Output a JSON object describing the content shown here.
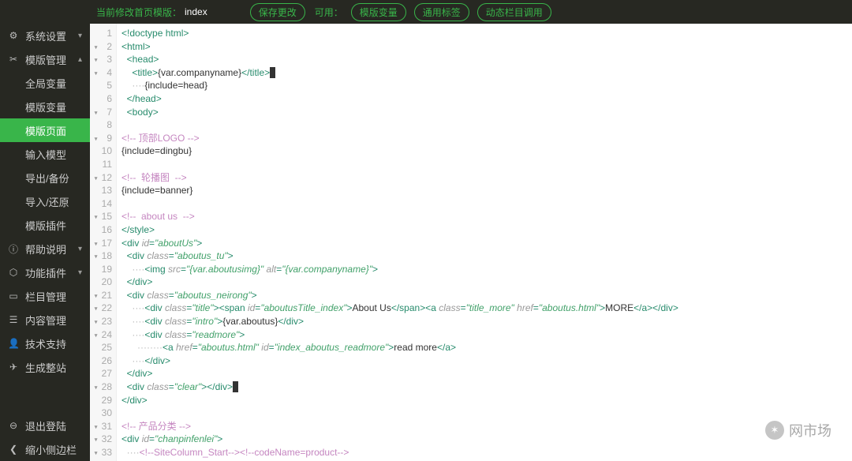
{
  "topbar": {
    "crumb_prefix": "当前修改首页模版：",
    "crumb_value": "index",
    "save_label": "保存更改",
    "avail_label": "可用：",
    "btn_tpl_var": "模版变量",
    "btn_common_tag": "通用标签",
    "btn_dynamic_col": "动态栏目调用"
  },
  "sidebar": {
    "items": [
      {
        "icon": "⚙",
        "label": "系统设置",
        "chev": "▾",
        "sub": false
      },
      {
        "icon": "✂",
        "label": "模版管理",
        "chev": "▴",
        "sub": false
      },
      {
        "icon": "",
        "label": "全局变量",
        "sub": true
      },
      {
        "icon": "",
        "label": "模版变量",
        "sub": true
      },
      {
        "icon": "",
        "label": "模版页面",
        "sub": true,
        "active": true
      },
      {
        "icon": "",
        "label": "输入模型",
        "sub": true
      },
      {
        "icon": "",
        "label": "导出/备份",
        "sub": true
      },
      {
        "icon": "",
        "label": "导入/还原",
        "sub": true
      },
      {
        "icon": "",
        "label": "模版插件",
        "sub": true
      },
      {
        "icon": "ⓘ",
        "label": "帮助说明",
        "chev": "▾",
        "sub": false
      },
      {
        "icon": "⬡",
        "label": "功能插件",
        "chev": "▾",
        "sub": false
      },
      {
        "icon": "▭",
        "label": "栏目管理",
        "sub": false
      },
      {
        "icon": "☰",
        "label": "内容管理",
        "sub": false
      },
      {
        "icon": "👤",
        "label": "技术支持",
        "sub": false
      },
      {
        "icon": "✈",
        "label": "生成整站",
        "sub": false
      }
    ],
    "footer": [
      {
        "icon": "⊖",
        "label": "退出登陆"
      },
      {
        "icon": "❮",
        "label": "缩小侧边栏"
      }
    ]
  },
  "watermark": {
    "text": "网市场"
  },
  "code_lines": [
    {
      "n": 1,
      "indent": 0,
      "raw": "<!doctype html>",
      "type": "tag"
    },
    {
      "n": 2,
      "fold": true,
      "indent": 0,
      "parts": [
        {
          "t": "tag",
          "s": "<html>"
        }
      ]
    },
    {
      "n": 3,
      "fold": true,
      "indent": 1,
      "parts": [
        {
          "t": "tag",
          "s": "<head>"
        }
      ]
    },
    {
      "n": 4,
      "fold": true,
      "indent": 2,
      "parts": [
        {
          "t": "tag",
          "s": "<title>"
        },
        {
          "t": "text",
          "s": "{var.companyname}"
        },
        {
          "t": "tag",
          "s": "</title>"
        },
        {
          "t": "cur",
          "s": "_"
        }
      ]
    },
    {
      "n": 5,
      "indent": 2,
      "parts": [
        {
          "t": "inv",
          "s": "····"
        },
        {
          "t": "text",
          "s": "{include=head}"
        }
      ]
    },
    {
      "n": 6,
      "indent": 1,
      "parts": [
        {
          "t": "tag",
          "s": "</head>"
        }
      ]
    },
    {
      "n": 7,
      "fold": true,
      "indent": 1,
      "parts": [
        {
          "t": "tag",
          "s": "<body>"
        }
      ]
    },
    {
      "n": 8,
      "indent": 0,
      "parts": []
    },
    {
      "n": 9,
      "fold": true,
      "indent": 0,
      "parts": [
        {
          "t": "comment",
          "s": "<!-- 顶部LOGO -->"
        }
      ]
    },
    {
      "n": 10,
      "indent": 0,
      "parts": [
        {
          "t": "text",
          "s": "{include=dingbu}"
        }
      ]
    },
    {
      "n": 11,
      "indent": 0,
      "parts": []
    },
    {
      "n": 12,
      "fold": true,
      "indent": 0,
      "parts": [
        {
          "t": "comment",
          "s": "<!--  轮播图  -->"
        }
      ]
    },
    {
      "n": 13,
      "indent": 0,
      "parts": [
        {
          "t": "text",
          "s": "{include=banner}"
        }
      ]
    },
    {
      "n": 14,
      "indent": 0,
      "parts": []
    },
    {
      "n": 15,
      "fold": true,
      "indent": 0,
      "parts": [
        {
          "t": "comment",
          "s": "<!--  about us  -->"
        }
      ]
    },
    {
      "n": 16,
      "indent": 0,
      "parts": [
        {
          "t": "tag",
          "s": "</"
        },
        {
          "t": "tagname",
          "s": "style"
        },
        {
          "t": "tag",
          "s": ">"
        }
      ]
    },
    {
      "n": 17,
      "fold": true,
      "indent": 0,
      "parts": [
        {
          "t": "tag",
          "s": "<div "
        },
        {
          "t": "attr",
          "s": "id"
        },
        {
          "t": "tag",
          "s": "="
        },
        {
          "t": "str",
          "s": "\"aboutUs\""
        },
        {
          "t": "tag",
          "s": ">"
        }
      ]
    },
    {
      "n": 18,
      "fold": true,
      "indent": 1,
      "parts": [
        {
          "t": "tag",
          "s": "<div "
        },
        {
          "t": "attr",
          "s": "class"
        },
        {
          "t": "tag",
          "s": "="
        },
        {
          "t": "str",
          "s": "\"aboutus_tu\""
        },
        {
          "t": "tag",
          "s": ">"
        }
      ]
    },
    {
      "n": 19,
      "indent": 2,
      "parts": [
        {
          "t": "inv",
          "s": "····"
        },
        {
          "t": "tag",
          "s": "<img "
        },
        {
          "t": "attr",
          "s": "src"
        },
        {
          "t": "tag",
          "s": "="
        },
        {
          "t": "str",
          "s": "\"{var.aboutusimg}\""
        },
        {
          "t": "tag",
          "s": " "
        },
        {
          "t": "attr",
          "s": "alt"
        },
        {
          "t": "tag",
          "s": "="
        },
        {
          "t": "str",
          "s": "\"{var.companyname}\""
        },
        {
          "t": "tag",
          "s": ">"
        }
      ]
    },
    {
      "n": 20,
      "indent": 1,
      "parts": [
        {
          "t": "tag",
          "s": "</div>"
        }
      ]
    },
    {
      "n": 21,
      "fold": true,
      "indent": 1,
      "parts": [
        {
          "t": "tag",
          "s": "<div "
        },
        {
          "t": "attr",
          "s": "class"
        },
        {
          "t": "tag",
          "s": "="
        },
        {
          "t": "str",
          "s": "\"aboutus_neirong\""
        },
        {
          "t": "tag",
          "s": ">"
        }
      ]
    },
    {
      "n": 22,
      "fold": true,
      "indent": 2,
      "parts": [
        {
          "t": "inv",
          "s": "····"
        },
        {
          "t": "tag",
          "s": "<div "
        },
        {
          "t": "attr",
          "s": "class"
        },
        {
          "t": "tag",
          "s": "="
        },
        {
          "t": "str",
          "s": "\"title\""
        },
        {
          "t": "tag",
          "s": "><span "
        },
        {
          "t": "attr",
          "s": "id"
        },
        {
          "t": "tag",
          "s": "="
        },
        {
          "t": "str",
          "s": "\"aboutusTitle_index\""
        },
        {
          "t": "tag",
          "s": ">"
        },
        {
          "t": "text",
          "s": "About Us"
        },
        {
          "t": "tag",
          "s": "</span><a "
        },
        {
          "t": "attr",
          "s": "class"
        },
        {
          "t": "tag",
          "s": "="
        },
        {
          "t": "str",
          "s": "\"title_more\""
        },
        {
          "t": "tag",
          "s": " "
        },
        {
          "t": "attr",
          "s": "href"
        },
        {
          "t": "tag",
          "s": "="
        },
        {
          "t": "str",
          "s": "\"aboutus.html\""
        },
        {
          "t": "tag",
          "s": ">"
        },
        {
          "t": "text",
          "s": "MORE"
        },
        {
          "t": "tag",
          "s": "</a></div>"
        }
      ]
    },
    {
      "n": 23,
      "fold": true,
      "indent": 2,
      "parts": [
        {
          "t": "inv",
          "s": "····"
        },
        {
          "t": "tag",
          "s": "<div "
        },
        {
          "t": "attr",
          "s": "class"
        },
        {
          "t": "tag",
          "s": "="
        },
        {
          "t": "str",
          "s": "\"intro\""
        },
        {
          "t": "tag",
          "s": ">"
        },
        {
          "t": "text",
          "s": "{var.aboutus}"
        },
        {
          "t": "tag",
          "s": "</div>"
        }
      ]
    },
    {
      "n": 24,
      "fold": true,
      "indent": 2,
      "parts": [
        {
          "t": "inv",
          "s": "····"
        },
        {
          "t": "tag",
          "s": "<div "
        },
        {
          "t": "attr",
          "s": "class"
        },
        {
          "t": "tag",
          "s": "="
        },
        {
          "t": "str",
          "s": "\"readmore\""
        },
        {
          "t": "tag",
          "s": ">"
        }
      ]
    },
    {
      "n": 25,
      "indent": 3,
      "parts": [
        {
          "t": "inv",
          "s": "········"
        },
        {
          "t": "tag",
          "s": "<a "
        },
        {
          "t": "attr",
          "s": "href"
        },
        {
          "t": "tag",
          "s": "="
        },
        {
          "t": "str",
          "s": "\"aboutus.html\""
        },
        {
          "t": "tag",
          "s": " "
        },
        {
          "t": "attr",
          "s": "id"
        },
        {
          "t": "tag",
          "s": "="
        },
        {
          "t": "str",
          "s": "\"index_aboutus_readmore\""
        },
        {
          "t": "tag",
          "s": ">"
        },
        {
          "t": "text",
          "s": "read more"
        },
        {
          "t": "tag",
          "s": "</a>"
        }
      ]
    },
    {
      "n": 26,
      "indent": 2,
      "parts": [
        {
          "t": "inv",
          "s": "····"
        },
        {
          "t": "tag",
          "s": "</div>"
        }
      ]
    },
    {
      "n": 27,
      "indent": 1,
      "parts": [
        {
          "t": "tag",
          "s": "</div>"
        }
      ]
    },
    {
      "n": 28,
      "fold": true,
      "indent": 1,
      "parts": [
        {
          "t": "tag",
          "s": "<div "
        },
        {
          "t": "attr",
          "s": "class"
        },
        {
          "t": "tag",
          "s": "="
        },
        {
          "t": "str",
          "s": "\"clear\""
        },
        {
          "t": "tag",
          "s": "></div>"
        },
        {
          "t": "cur",
          "s": "_"
        }
      ]
    },
    {
      "n": 29,
      "indent": 0,
      "parts": [
        {
          "t": "tag",
          "s": "</div>"
        }
      ]
    },
    {
      "n": 30,
      "indent": 0,
      "parts": []
    },
    {
      "n": 31,
      "fold": true,
      "indent": 0,
      "parts": [
        {
          "t": "comment",
          "s": "<!-- 产品分类 -->"
        }
      ]
    },
    {
      "n": 32,
      "fold": true,
      "indent": 0,
      "parts": [
        {
          "t": "tag",
          "s": "<div "
        },
        {
          "t": "attr",
          "s": "id"
        },
        {
          "t": "tag",
          "s": "="
        },
        {
          "t": "str",
          "s": "\"chanpinfenlei\""
        },
        {
          "t": "tag",
          "s": ">"
        }
      ]
    },
    {
      "n": 33,
      "fold": true,
      "indent": 1,
      "parts": [
        {
          "t": "inv",
          "s": "····"
        },
        {
          "t": "comment",
          "s": "<!--SiteColumn_Start--><!--codeName=product-->"
        }
      ]
    }
  ]
}
